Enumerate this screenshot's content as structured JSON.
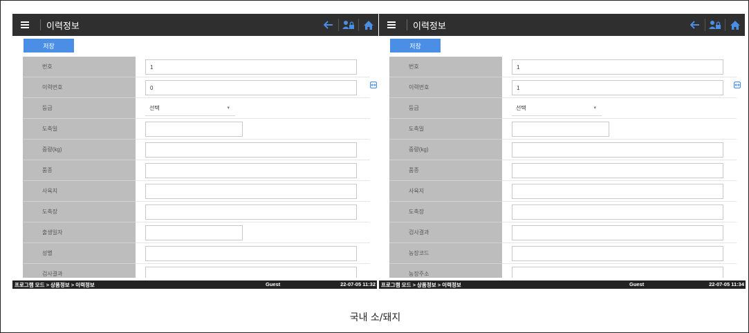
{
  "screens": [
    {
      "title": "이력정보",
      "save_label": "저장",
      "fields": [
        {
          "label": "번호",
          "value": "1",
          "kind": "wide"
        },
        {
          "label": "이력번호",
          "value": "0",
          "kind": "wide"
        },
        {
          "label": "등급",
          "value": "선택",
          "kind": "select"
        },
        {
          "label": "도축일",
          "value": "",
          "kind": "short"
        },
        {
          "label": "중량(kg)",
          "value": "",
          "kind": "wide"
        },
        {
          "label": "품종",
          "value": "",
          "kind": "wide"
        },
        {
          "label": "사육지",
          "value": "",
          "kind": "wide"
        },
        {
          "label": "도축장",
          "value": "",
          "kind": "wide"
        },
        {
          "label": "출생일자",
          "value": "",
          "kind": "short"
        },
        {
          "label": "성별",
          "value": "",
          "kind": "wide"
        },
        {
          "label": "검사결과",
          "value": "",
          "kind": "wide"
        }
      ],
      "status": {
        "breadcrumb": "프로그램 모드 > 상품정보 > 이력정보",
        "user": "Guest",
        "datetime": "22-07-05 11:32"
      }
    },
    {
      "title": "이력정보",
      "save_label": "저장",
      "fields": [
        {
          "label": "번호",
          "value": "1",
          "kind": "wide"
        },
        {
          "label": "이력번호",
          "value": "1",
          "kind": "wide"
        },
        {
          "label": "등급",
          "value": "선택",
          "kind": "select"
        },
        {
          "label": "도축일",
          "value": "",
          "kind": "short"
        },
        {
          "label": "중량(kg)",
          "value": "",
          "kind": "wide"
        },
        {
          "label": "품종",
          "value": "",
          "kind": "wide"
        },
        {
          "label": "사육지",
          "value": "",
          "kind": "wide"
        },
        {
          "label": "도축장",
          "value": "",
          "kind": "wide"
        },
        {
          "label": "검사결과",
          "value": "",
          "kind": "wide"
        },
        {
          "label": "농장코드",
          "value": "",
          "kind": "wide"
        },
        {
          "label": "농장주소",
          "value": "",
          "kind": "wide"
        }
      ],
      "status": {
        "breadcrumb": "프로그램 모드 > 상품정보 > 이력정보",
        "user": "Guest",
        "datetime": "22-07-05 11:34"
      }
    }
  ],
  "icons": {
    "menu": "hamburger-menu-icon",
    "back": "back-arrow-icon",
    "user": "user-lock-icon",
    "home": "home-icon",
    "handle": "scroll-handle-icon"
  },
  "colors": {
    "topbar": "#2f2f2f",
    "accent": "#4a8ee6",
    "label_bg": "#bdbdbd",
    "statusbar": "#222222"
  },
  "caption": "국내 소/돼지"
}
